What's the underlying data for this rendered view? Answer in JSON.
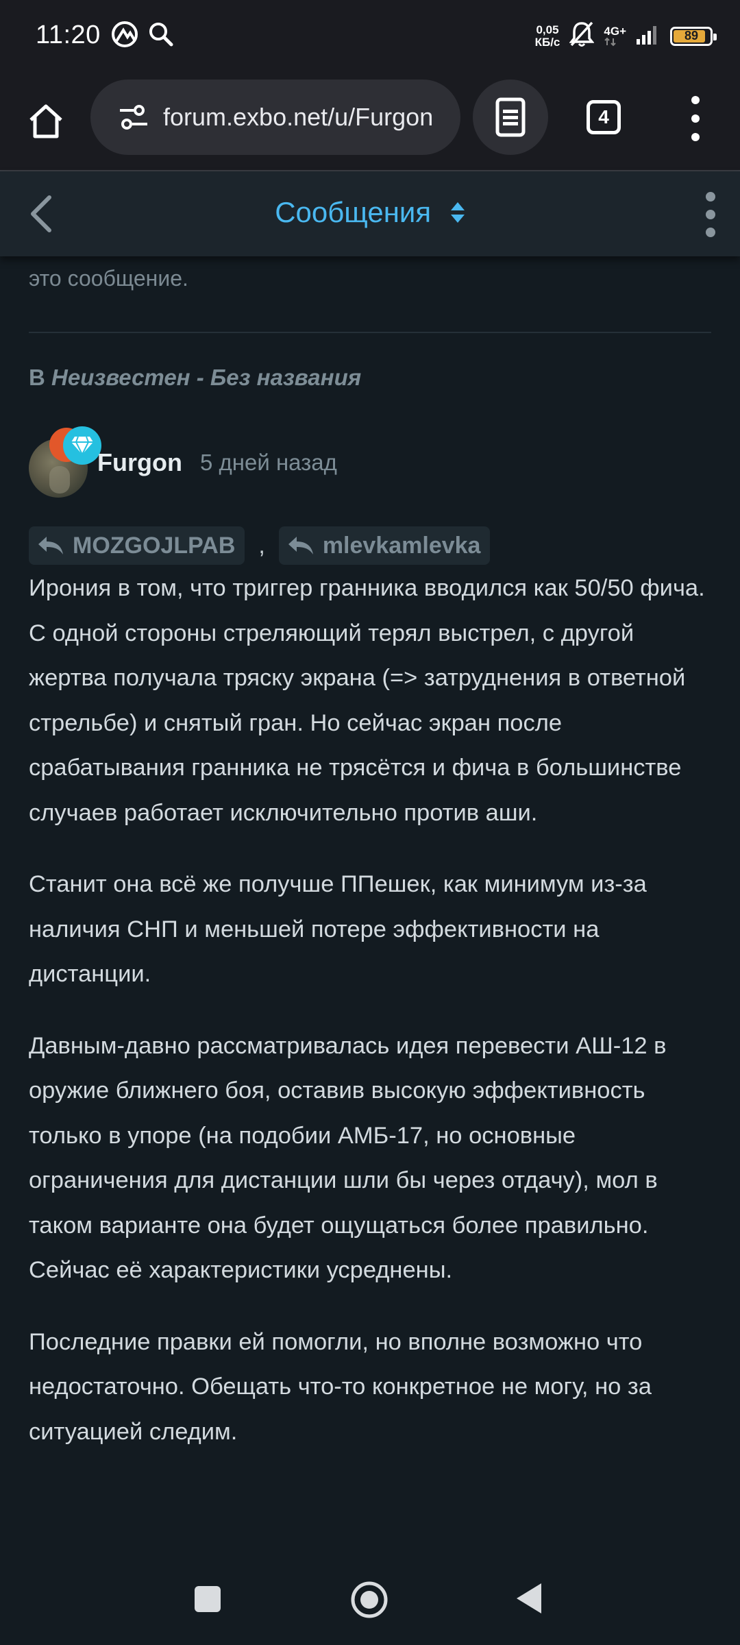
{
  "status_bar": {
    "time": "11:20",
    "net_rate_value": "0,05",
    "net_rate_unit": "КБ/с",
    "network": "4G+",
    "battery": "89",
    "battery_level": 0.89,
    "icons": [
      "gallery-icon",
      "search-icon",
      "bell-off-icon",
      "signal-icon",
      "battery-icon"
    ]
  },
  "browser": {
    "url": "forum.exbo.net/u/Furgon",
    "tab_count": "4",
    "icons": [
      "home-icon",
      "tune-icon",
      "reader-mode-icon",
      "tabs-icon",
      "more-vert-icon"
    ]
  },
  "app_header": {
    "title": "Сообщения",
    "icons": [
      "back-icon",
      "sort-icon",
      "kebab-icon"
    ]
  },
  "feed": {
    "prev_tail": "это сообщение.",
    "thread_prefix": "В",
    "thread_title": "Неизвестен - Без названия",
    "post": {
      "author": "Furgon",
      "time_ago": "5 дней назад",
      "replies": [
        "MOZGOJLPAB",
        "mlevkamlevka"
      ],
      "reply_separator": ",",
      "paragraphs": [
        "Ирония в том, что триггер гранника вводился как 50/50 фича. С одной стороны стреляющий терял выстрел, с другой жертва получала тряску экрана (=> затруднения в ответной стрельбе) и снятый гран. Но сейчас экран после срабатывания гранника не трясётся и фича в большинстве случаев работает исключительно против аши.",
        "Станит она всё же получше ППешек, как минимум из-за наличия СНП и меньшей потере эффективности на дистанции.",
        "Давным-давно рассматривалась идея перевести АШ-12 в оружие ближнего боя, оставив высокую эффективность только в упоре (на подобии АМБ-17, но основные ограничения для дистанции шли бы через отдачу), мол в таком варианте она будет ощущаться более правильно. Сейчас её характеристики усреднены.",
        "Последние правки ей помогли, но вполне возможно что недостаточно. Обещать что-то конкретное не могу, но за ситуацией следим."
      ]
    }
  },
  "colors": {
    "background": "#131b21",
    "header_accent": "#4ab8f0",
    "muted_text": "#7d8d96",
    "body_text": "#d3dadf",
    "battery": "#e5a93a"
  },
  "nav": {
    "icons": [
      "recents-icon",
      "home-circle-icon",
      "back-triangle-icon"
    ]
  }
}
